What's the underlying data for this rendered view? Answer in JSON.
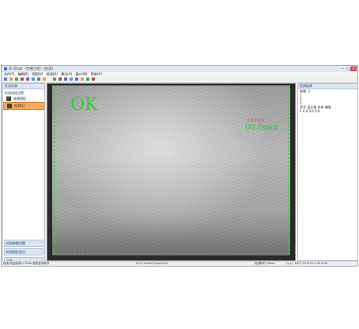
{
  "window": {
    "title": "Qi Vision - [定制工程] - [检测]",
    "controls": {
      "min": "—",
      "max": "□",
      "close": "✕"
    }
  },
  "menu": [
    "文件(F)",
    "编辑(E)",
    "视图(V)",
    "检测(D)",
    "算法(A)",
    "窗口(W)",
    "帮助(H)"
  ],
  "toolbar_icons": [
    "new-icon",
    "open-icon",
    "save-icon",
    "cut-icon",
    "copy-icon",
    "paste-icon",
    "undo-icon",
    "redo-icon",
    "grab-icon",
    "camera-icon",
    "run-icon",
    "stop-icon",
    "zoom-in-icon",
    "zoom-out-icon",
    "fit-icon",
    "settings-icon"
  ],
  "left_panel": {
    "title": "任务列表",
    "tree_header": "检测流程设置",
    "items": [
      {
        "label": "连接相机"
      },
      {
        "label": "检测(1)"
      }
    ],
    "bottom_tabs": [
      "检测参数设置",
      "检测图形显示",
      "日志"
    ]
  },
  "viewer": {
    "result": "OK",
    "annotation_red": "0 0 0 0 0",
    "annotation_green": "00.0mm",
    "footer": "D:\\Qi Vision\\Project\\Pro"
  },
  "right_panel": {
    "title": "检测结果",
    "lines": [
      "结果: 1",
      "1",
      "2",
      "3",
      "序号  设计值  实测  偏差",
      "1    0.0    0.0   0.0"
    ],
    "tabs": [
      "检测设置",
      "结果",
      "相机参数",
      "检测参数"
    ]
  },
  "status": {
    "left": "就绪 欢迎使用Qi Vision视觉检测软件",
    "center": "检测耗时: 68ms",
    "right": "(x,y): 1877,78  R:50 G:50 B:50"
  }
}
